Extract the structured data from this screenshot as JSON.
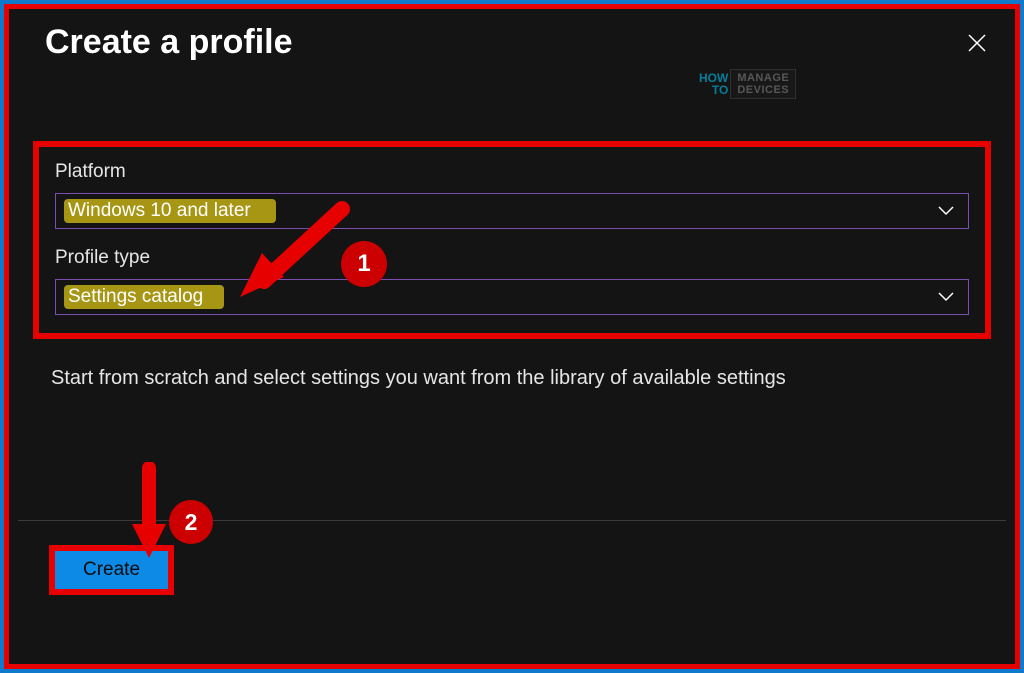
{
  "dialog": {
    "title": "Create a profile"
  },
  "watermark": {
    "line1": "HOW",
    "line2": "TO",
    "brand_top": "MANAGE",
    "brand_bottom": "DEVICES"
  },
  "form": {
    "platform_label": "Platform",
    "platform_value": "Windows 10 and later",
    "profile_type_label": "Profile type",
    "profile_type_value": "Settings catalog",
    "description": "Start from scratch and select settings you want from the library of available settings"
  },
  "actions": {
    "create_label": "Create"
  },
  "annotations": {
    "callout1": "1",
    "callout2": "2"
  }
}
